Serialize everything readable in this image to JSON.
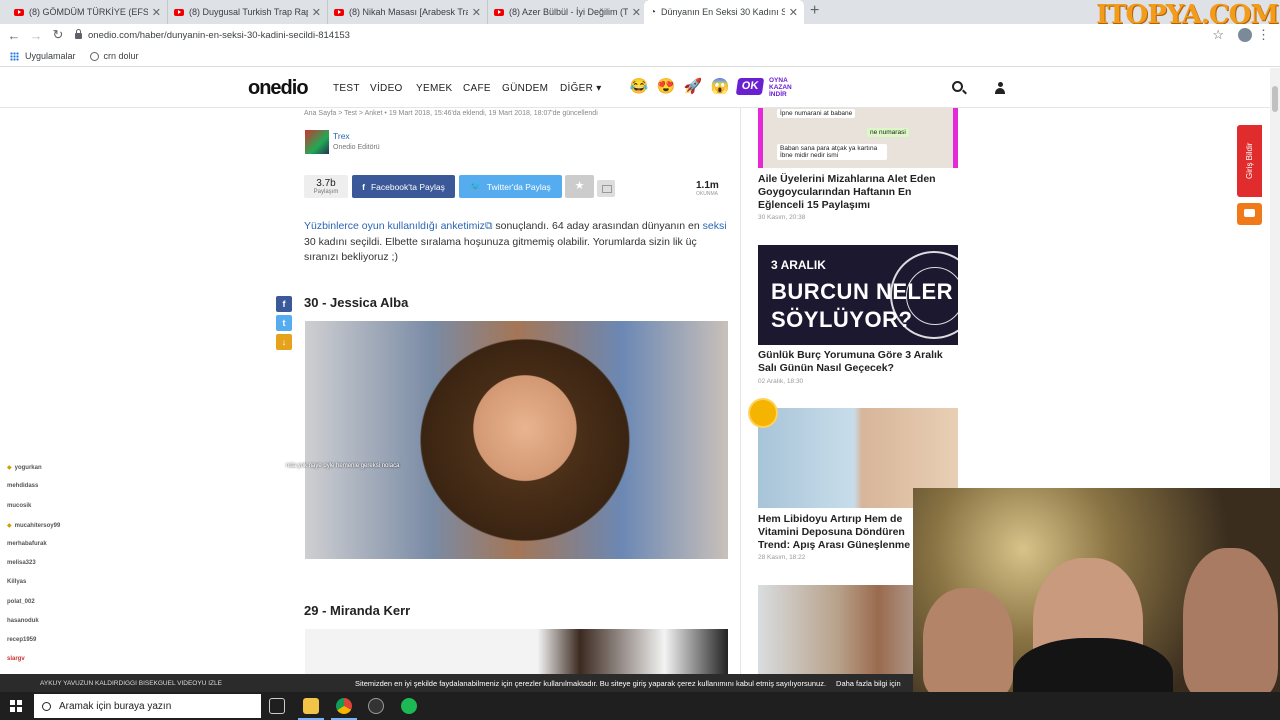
{
  "browser": {
    "tabs": [
      {
        "title": "(8) GÖMDÜM TÜRKİYE (EFSANE",
        "icon": "youtube-icon"
      },
      {
        "title": "(8) Duygusal Turkish Trap Rap Be",
        "icon": "youtube-icon"
      },
      {
        "title": "(8) Nikah Masası [Arabesk Trap Beat",
        "icon": "youtube-icon"
      },
      {
        "title": "(8) Azer Bülbül - İyi Değilim (Tufa",
        "icon": "youtube-icon"
      },
      {
        "title": "Dünyanın En Seksi 30 Kadını Seç",
        "icon": "onedio-icon"
      }
    ],
    "new_tab": "+",
    "url": "onedio.com/haber/dunyanin-en-seksi-30-kadini-secildi-814153",
    "bookmarks": [
      {
        "label": "Uygulamalar"
      },
      {
        "label": "crn dolur"
      }
    ],
    "watermark": "ITOPYA.COM"
  },
  "site": {
    "logo": "onedio",
    "menu": [
      "TEST",
      "VİDEO",
      "YEMEK",
      "CAFE",
      "GÜNDEM",
      "DİĞER"
    ],
    "ok_badge": "OK",
    "oyna": [
      "OYNA",
      "KAZAN",
      "İNDİR"
    ]
  },
  "article": {
    "breadcrumb": "Ana Sayfa > Test > Anket  •  19 Mart 2018, 15:46'da eklendi, 19 Mart 2018, 18:07'de güncellendi",
    "author": "Trex",
    "author_role": "Onedio Editörü",
    "share_count": "3.7b",
    "share_label": "Paylaşım",
    "facebook_btn": "Facebook'ta Paylaş",
    "twitter_btn": "Twitter'da Paylaş",
    "views": "1.1m",
    "views_label": "OKUNMA",
    "intro_link1": "Yüzbinlerce oyun kullanıldığı anketimiz",
    "intro_part2": " sonuçlandı. 64 aday arasından dünyanın en ",
    "intro_link2": "seksi",
    "intro_part3": " 30 kadını seçildi. Elbette sıralama hoşunuza gitmemiş olabilir. Yorumlarda sizin lik üç sıranızı bekliyoruz ;)",
    "items": [
      "30 - Jessica Alba",
      "29 - Miranda Kerr"
    ]
  },
  "sidebar": {
    "chat_bubbles": [
      "İpne numarani at babane",
      "ne numarasi",
      "Baban sana para atçak ya kartına İbne midir nedir ismi"
    ],
    "cards": [
      {
        "title": "Aile Üyelerini Mizahlarına Alet Eden Goygoycularından Haftanın En Eğlenceli 15 Paylaşımı",
        "date": "30 Kasım, 20:38"
      },
      {
        "title": "Günlük Burç Yorumuna Göre 3 Aralık Salı Günün Nasıl Geçecek?",
        "date": "02 Aralık, 18:30"
      },
      {
        "title": "Hem Libidoyu Artırıp Hem de Vitamini Deposuna Döndüren Trend: Apış Arası Güneşlenme",
        "date": "28 Kasım, 18:22"
      }
    ],
    "burc_l1": "3 ARALIK",
    "burc_l2": "BURCUN NELER",
    "burc_l3": "SÖYLÜYOR?",
    "giris": "Giriş Bildir"
  },
  "stream_chat": [
    {
      "user": "yogurkan",
      "msg": ""
    },
    {
      "user": "mehdidass",
      "msg": ""
    },
    {
      "user": "mucosik",
      "msg": ""
    },
    {
      "user": "mucahitersoy99",
      "msg": ""
    },
    {
      "user": "merhabafurak",
      "msg": ""
    },
    {
      "user": "melisa323",
      "msg": ""
    },
    {
      "user": "Killyas",
      "msg": ""
    },
    {
      "user": "polat_002",
      "msg": ""
    },
    {
      "user": "hasanoduk",
      "msg": ""
    },
    {
      "user": "recep1959",
      "msg": ""
    },
    {
      "user": "slargv",
      "msg": ""
    }
  ],
  "overlay_line": "nda yok naye oyle hemenle gereksi nolaca",
  "stream_bar": "AYKUY YAVUZUN KALDIRDIGGI BISEKGUEL VIDEOYU IZLE",
  "cookie": {
    "text": "Sitemizden en iyi şekilde faydalanabilmeniz için çerezler kullanılmaktadır. Bu siteye giriş yaparak çerez kullanımını kabul etmiş sayılıyorsunuz.",
    "link": "Daha fazla bilgi için"
  },
  "taskbar": {
    "search_placeholder": "Aramak için buraya yazın"
  },
  "colors": {
    "facebook": "#3b5998",
    "twitter": "#55acee",
    "link": "#2b65b3",
    "accent_red": "#e02c2c"
  }
}
